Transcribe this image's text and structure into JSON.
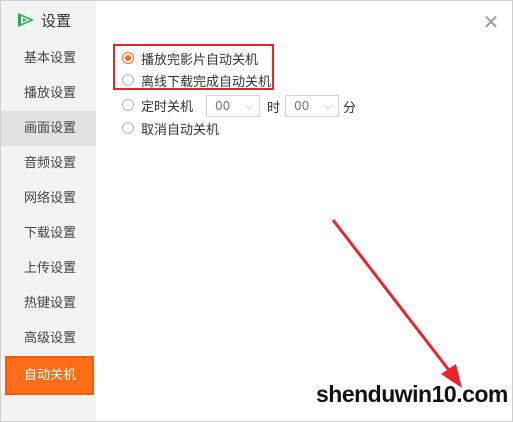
{
  "app": {
    "title": "设置"
  },
  "sidebar": {
    "items": [
      {
        "label": "基本设置"
      },
      {
        "label": "播放设置"
      },
      {
        "label": "画面设置"
      },
      {
        "label": "音频设置"
      },
      {
        "label": "网络设置"
      },
      {
        "label": "下载设置"
      },
      {
        "label": "上传设置"
      },
      {
        "label": "热键设置"
      },
      {
        "label": "高级设置"
      },
      {
        "label": "自动关机"
      }
    ],
    "active_index": 9
  },
  "options": {
    "after_play": "播放完影片自动关机",
    "after_download": "离线下载完成自动关机",
    "timed": "定时关机",
    "cancel": "取消自动关机",
    "selected": "after_play"
  },
  "timer": {
    "hour_value": "00",
    "hour_unit": "时",
    "minute_value": "00",
    "minute_unit": "分"
  },
  "colors": {
    "accent": "#ff6d16",
    "highlight": "#e8242c"
  },
  "watermark": "shenduwin10.com"
}
